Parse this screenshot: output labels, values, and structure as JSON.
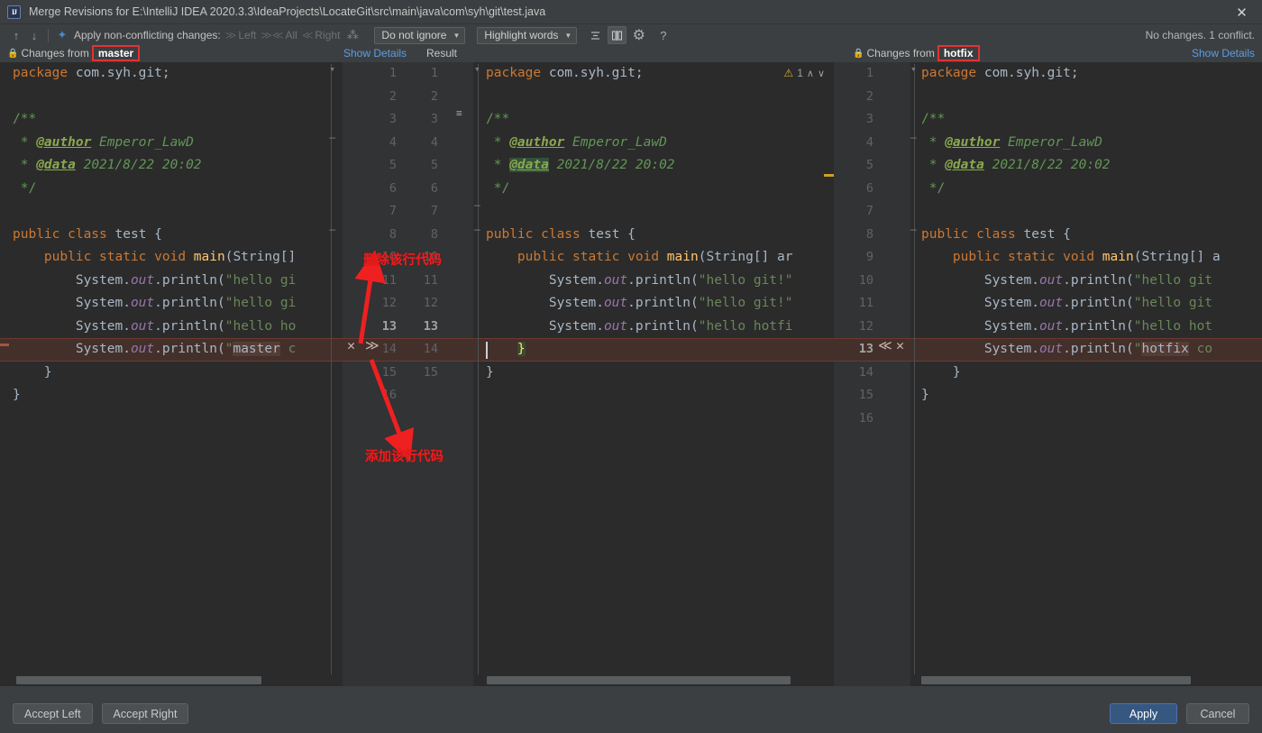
{
  "window": {
    "title": "Merge Revisions for E:\\IntelliJ IDEA 2020.3.3\\IdeaProjects\\LocateGit\\src\\main\\java\\com\\syh\\git\\test.java",
    "logo_text": "IJ",
    "close_icon": "✕"
  },
  "toolbar": {
    "prev_icon": "↑",
    "next_icon": "↓",
    "magic_icon": "✦",
    "apply_label": "Apply non-conflicting changes:",
    "left_chevron": "≫",
    "left_label": "Left",
    "all_chevron": "≫≪",
    "all_label": "All",
    "right_chevron": "≪",
    "right_label": "Right",
    "wand_icon": "⁂",
    "ignore_select": "Do not ignore",
    "highlight_select": "Highlight words",
    "collapse_icon": "≡",
    "columns_icon": "‖",
    "gear_icon": "⚙",
    "help_icon": "?",
    "status": "No changes. 1 conflict.",
    "show_details": "Show Details"
  },
  "header": {
    "lock_icon": "🔒",
    "left": {
      "prefix": "Changes from",
      "branch": "master"
    },
    "right": {
      "prefix": "Changes from",
      "branch": "hotfix"
    },
    "center_show_details": "Show Details",
    "center_result": "Result"
  },
  "left_pane": {
    "line_numbers": [
      "1",
      "2",
      "3",
      "4",
      "5",
      "6",
      "7",
      "8",
      "10",
      "11",
      "12",
      "13",
      "14",
      "15",
      "16"
    ],
    "lines": [
      {
        "n": 1,
        "tokens": [
          {
            "t": "package ",
            "c": "kw"
          },
          {
            "t": "com.syh.git;",
            "c": "txt"
          }
        ]
      },
      {
        "n": 2,
        "tokens": []
      },
      {
        "n": 3,
        "tokens": [
          {
            "t": "/**",
            "c": "cmt"
          }
        ]
      },
      {
        "n": 4,
        "tokens": [
          {
            "t": " * ",
            "c": "cmt"
          },
          {
            "t": "@author",
            "c": "tag"
          },
          {
            "t": " Emperor_LawD",
            "c": "cmi"
          }
        ]
      },
      {
        "n": 5,
        "tokens": [
          {
            "t": " * ",
            "c": "cmt"
          },
          {
            "t": "@data",
            "c": "tag"
          },
          {
            "t": " 2021/8/22 20:02",
            "c": "cmi"
          }
        ]
      },
      {
        "n": 6,
        "tokens": [
          {
            "t": " */",
            "c": "cmt"
          }
        ]
      },
      {
        "n": 7,
        "tokens": []
      },
      {
        "n": 8,
        "tokens": [
          {
            "t": "public class ",
            "c": "kw"
          },
          {
            "t": "test",
            "c": "txt"
          },
          {
            "t": " {",
            "c": "txt"
          }
        ]
      },
      {
        "n": 9,
        "tokens": [
          {
            "t": "    ",
            "c": "txt"
          },
          {
            "t": "public static void ",
            "c": "kw"
          },
          {
            "t": "main",
            "c": "mth"
          },
          {
            "t": "(String[]",
            "c": "txt"
          }
        ]
      },
      {
        "n": 10,
        "tokens": [
          {
            "t": "        System.",
            "c": "txt"
          },
          {
            "t": "out",
            "c": "fld"
          },
          {
            "t": ".println(",
            "c": "txt"
          },
          {
            "t": "\"hello gi",
            "c": "str"
          }
        ]
      },
      {
        "n": 11,
        "tokens": [
          {
            "t": "        System.",
            "c": "txt"
          },
          {
            "t": "out",
            "c": "fld"
          },
          {
            "t": ".println(",
            "c": "txt"
          },
          {
            "t": "\"hello gi",
            "c": "str"
          }
        ]
      },
      {
        "n": 12,
        "tokens": [
          {
            "t": "        System.",
            "c": "txt"
          },
          {
            "t": "out",
            "c": "fld"
          },
          {
            "t": ".println(",
            "c": "txt"
          },
          {
            "t": "\"hello ho",
            "c": "str"
          }
        ]
      },
      {
        "n": 13,
        "tokens": [
          {
            "t": "        System.",
            "c": "txt"
          },
          {
            "t": "out",
            "c": "fld"
          },
          {
            "t": ".println(",
            "c": "txt"
          },
          {
            "t": "\"",
            "c": "str"
          },
          {
            "t": "master",
            "c": "hl-word"
          },
          {
            "t": " c",
            "c": "str"
          }
        ]
      },
      {
        "n": 14,
        "tokens": [
          {
            "t": "    }",
            "c": "txt"
          }
        ]
      },
      {
        "n": 15,
        "tokens": [
          {
            "t": "}",
            "c": "txt"
          }
        ]
      }
    ]
  },
  "result_pane": {
    "line_numbers": [
      "1",
      "2",
      "3",
      "4",
      "5",
      "6",
      "7",
      "8",
      "10",
      "11",
      "12",
      "13",
      "14",
      "15"
    ],
    "warning_count": "1",
    "warning_icon": "⚠",
    "warn_up": "∧",
    "warn_down": "∨",
    "lines": [
      {
        "n": 1,
        "tokens": [
          {
            "t": "package ",
            "c": "kw"
          },
          {
            "t": "com.syh.git;",
            "c": "txt"
          }
        ]
      },
      {
        "n": 2,
        "tokens": []
      },
      {
        "n": 3,
        "tokens": [
          {
            "t": "/**",
            "c": "cmt"
          }
        ]
      },
      {
        "n": 4,
        "tokens": [
          {
            "t": " * ",
            "c": "cmt"
          },
          {
            "t": "@author",
            "c": "tag"
          },
          {
            "t": " Emperor_LawD",
            "c": "cmi"
          }
        ]
      },
      {
        "n": 5,
        "tokens": [
          {
            "t": " * ",
            "c": "cmt"
          },
          {
            "t": "@data",
            "c": "hl-tag tag"
          },
          {
            "t": " 2021/8/22 20:02",
            "c": "cmi"
          }
        ]
      },
      {
        "n": 6,
        "tokens": [
          {
            "t": " */",
            "c": "cmt"
          }
        ]
      },
      {
        "n": 7,
        "tokens": []
      },
      {
        "n": 8,
        "tokens": [
          {
            "t": "public class ",
            "c": "kw"
          },
          {
            "t": "test",
            "c": "txt"
          },
          {
            "t": " {",
            "c": "txt"
          }
        ]
      },
      {
        "n": 9,
        "tokens": [
          {
            "t": "    ",
            "c": "txt"
          },
          {
            "t": "public static void ",
            "c": "kw"
          },
          {
            "t": "main",
            "c": "mth"
          },
          {
            "t": "(String[] ar",
            "c": "txt"
          }
        ]
      },
      {
        "n": 10,
        "tokens": [
          {
            "t": "        System.",
            "c": "txt"
          },
          {
            "t": "out",
            "c": "fld"
          },
          {
            "t": ".println(",
            "c": "txt"
          },
          {
            "t": "\"hello git!\"",
            "c": "str"
          }
        ]
      },
      {
        "n": 11,
        "tokens": [
          {
            "t": "        System.",
            "c": "txt"
          },
          {
            "t": "out",
            "c": "fld"
          },
          {
            "t": ".println(",
            "c": "txt"
          },
          {
            "t": "\"hello git!\"",
            "c": "str"
          }
        ]
      },
      {
        "n": 12,
        "tokens": [
          {
            "t": "        System.",
            "c": "txt"
          },
          {
            "t": "out",
            "c": "fld"
          },
          {
            "t": ".println(",
            "c": "txt"
          },
          {
            "t": "\"hello hotfi",
            "c": "str"
          }
        ]
      },
      {
        "n": 13,
        "tokens": [
          {
            "t": "    ",
            "c": "txt"
          },
          {
            "t": "}",
            "c": "hl-brace"
          }
        ]
      },
      {
        "n": 14,
        "tokens": [
          {
            "t": "}",
            "c": "txt"
          }
        ]
      }
    ]
  },
  "right_pane": {
    "line_numbers": [
      "1",
      "2",
      "3",
      "4",
      "5",
      "6",
      "7",
      "8",
      "9",
      "10",
      "11",
      "12",
      "13",
      "14",
      "15",
      "16"
    ],
    "lines": [
      {
        "n": 1,
        "tokens": [
          {
            "t": "package ",
            "c": "kw"
          },
          {
            "t": "com.syh.git;",
            "c": "txt"
          }
        ]
      },
      {
        "n": 2,
        "tokens": []
      },
      {
        "n": 3,
        "tokens": [
          {
            "t": "/**",
            "c": "cmt"
          }
        ]
      },
      {
        "n": 4,
        "tokens": [
          {
            "t": " * ",
            "c": "cmt"
          },
          {
            "t": "@author",
            "c": "tag"
          },
          {
            "t": " Emperor_LawD",
            "c": "cmi"
          }
        ]
      },
      {
        "n": 5,
        "tokens": [
          {
            "t": " * ",
            "c": "cmt"
          },
          {
            "t": "@data",
            "c": "tag"
          },
          {
            "t": " 2021/8/22 20:02",
            "c": "cmi"
          }
        ]
      },
      {
        "n": 6,
        "tokens": [
          {
            "t": " */",
            "c": "cmt"
          }
        ]
      },
      {
        "n": 7,
        "tokens": []
      },
      {
        "n": 8,
        "tokens": [
          {
            "t": "public class ",
            "c": "kw"
          },
          {
            "t": "test",
            "c": "txt"
          },
          {
            "t": " {",
            "c": "txt"
          }
        ]
      },
      {
        "n": 9,
        "tokens": [
          {
            "t": "    ",
            "c": "txt"
          },
          {
            "t": "public static void ",
            "c": "kw"
          },
          {
            "t": "main",
            "c": "mth"
          },
          {
            "t": "(String[] a",
            "c": "txt"
          }
        ]
      },
      {
        "n": 10,
        "tokens": [
          {
            "t": "        System.",
            "c": "txt"
          },
          {
            "t": "out",
            "c": "fld"
          },
          {
            "t": ".println(",
            "c": "txt"
          },
          {
            "t": "\"hello git",
            "c": "str"
          }
        ]
      },
      {
        "n": 11,
        "tokens": [
          {
            "t": "        System.",
            "c": "txt"
          },
          {
            "t": "out",
            "c": "fld"
          },
          {
            "t": ".println(",
            "c": "txt"
          },
          {
            "t": "\"hello git",
            "c": "str"
          }
        ]
      },
      {
        "n": 12,
        "tokens": [
          {
            "t": "        System.",
            "c": "txt"
          },
          {
            "t": "out",
            "c": "fld"
          },
          {
            "t": ".println(",
            "c": "txt"
          },
          {
            "t": "\"hello hot",
            "c": "str"
          }
        ]
      },
      {
        "n": 13,
        "tokens": [
          {
            "t": "        System.",
            "c": "txt"
          },
          {
            "t": "out",
            "c": "fld"
          },
          {
            "t": ".println(",
            "c": "txt"
          },
          {
            "t": "\"",
            "c": "str"
          },
          {
            "t": "hotfix",
            "c": "hl-word"
          },
          {
            "t": " co",
            "c": "str"
          }
        ]
      },
      {
        "n": 14,
        "tokens": [
          {
            "t": "    }",
            "c": "txt"
          }
        ]
      },
      {
        "n": 15,
        "tokens": [
          {
            "t": "}",
            "c": "txt"
          }
        ]
      }
    ]
  },
  "gutter_actions": {
    "left_revert_icon": "✕",
    "left_apply_icon": "≫",
    "left_line": "13",
    "right_apply_icon": "≪",
    "right_revert_icon": "✕",
    "right_line": "13"
  },
  "annotations": {
    "delete_note": "删除该行代码",
    "add_note": "添加该行代码"
  },
  "footer": {
    "accept_left": "Accept Left",
    "accept_right": "Accept Right",
    "apply": "Apply",
    "cancel": "Cancel"
  },
  "colors": {
    "accent_blue": "#365880",
    "annotation_red": "#e81f1f",
    "conflict_bg": "#43302b",
    "editor_bg": "#2b2b2b",
    "chrome_bg": "#3c3f41"
  }
}
